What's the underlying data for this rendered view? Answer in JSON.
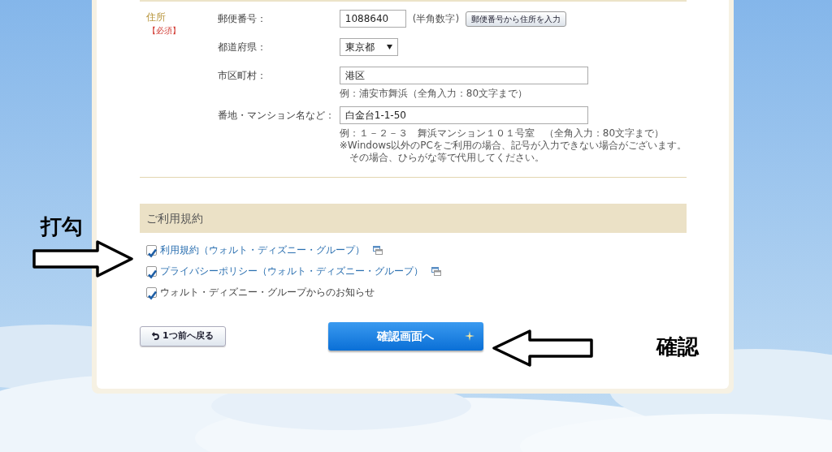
{
  "address_section": {
    "label": "住所",
    "required": "【必須】",
    "fields": [
      {
        "kind": "postal",
        "label": "郵便番号：",
        "value": "1088640",
        "note": "(半角数字)",
        "button": "郵便番号から住所を入力"
      },
      {
        "kind": "select",
        "label": "都道府県：",
        "value": "東京都"
      },
      {
        "kind": "text",
        "label": "市区町村：",
        "value": "港区",
        "hints": [
          "例：浦安市舞浜（全角入力：80文字まで）"
        ]
      },
      {
        "kind": "text",
        "label": "番地・マンション名など：",
        "value": "白金台1-1-50",
        "hints": [
          "例：１－２－３　舞浜マンション１０１号室　（全角入力：80文字まで）",
          "※Windows以外のPCをご利用の場合、記号が入力できない場合がございます。",
          "　その場合、ひらがな等で代用してください。"
        ]
      }
    ]
  },
  "terms": {
    "heading": "ご利用規約",
    "items": [
      {
        "label": "利用規約（ウォルト・ディズニー・グループ）",
        "checked": true,
        "kind": "link"
      },
      {
        "label": "プライバシーポリシー（ウォルト・ディズニー・グループ）",
        "checked": true,
        "kind": "link"
      },
      {
        "label": "ウォルト・ディズニー・グループからのお知らせ",
        "checked": true,
        "kind": "plain"
      }
    ]
  },
  "buttons": {
    "back": "1つ前へ戻る",
    "confirm": "確認画面へ"
  },
  "annotations": [
    {
      "text": "打勾",
      "kind": "right-arrow"
    },
    {
      "text": "確認",
      "kind": "left-arrow"
    }
  ]
}
